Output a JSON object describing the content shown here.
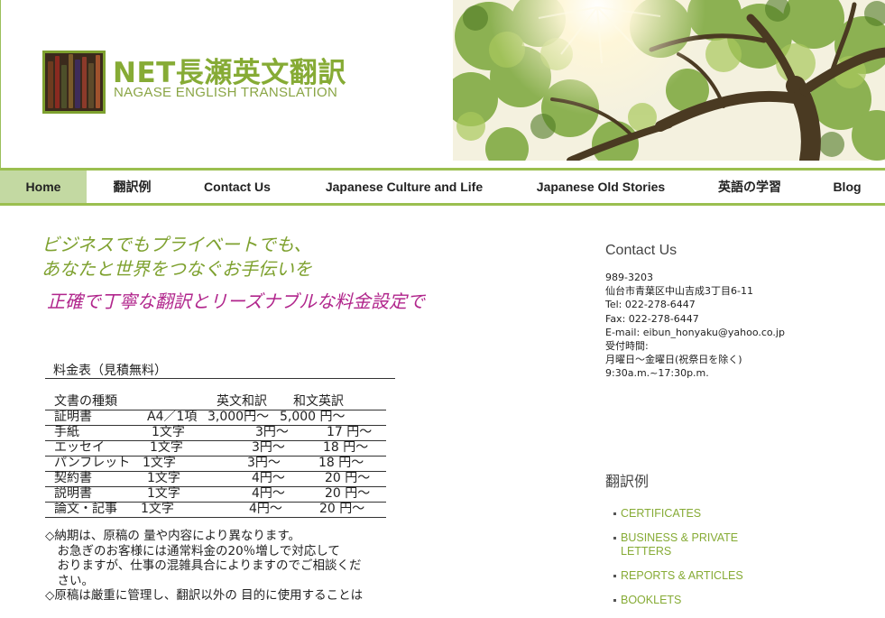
{
  "header": {
    "title": "NET長瀬英文翻訳",
    "subtitle": "NAGASE ENGLISH TRANSLATION"
  },
  "nav": {
    "items": [
      "Home",
      "翻訳例",
      "Contact Us",
      "Japanese Culture and Life",
      "Japanese Old Stories",
      "英語の学習",
      "Blog"
    ],
    "active": "Home"
  },
  "tagline": {
    "line1": "ビジネスでもプライベートでも、",
    "line2": "あなたと世界をつなぐお手伝いを",
    "line3": "正確で丁寧な翻訳とリーズナブルな料金設定で"
  },
  "pricing": {
    "title": "料金表（見積無料）",
    "headers": {
      "type": "文書の種類",
      "en_ja": "英文和訳",
      "ja_en": "和文英訳"
    },
    "rows": [
      {
        "type": "証明書",
        "unit": "A4／1項",
        "en_ja": "3,000円〜",
        "ja_en": "5,000 円〜"
      },
      {
        "type": "手紙",
        "unit": "1文字",
        "en_ja": "3円〜",
        "ja_en": "17 円〜"
      },
      {
        "type": "エッセイ",
        "unit": "1文字",
        "en_ja": "3円〜",
        "ja_en": "18 円〜"
      },
      {
        "type": "パンフレット",
        "unit": "1文字",
        "en_ja": "3円〜",
        "ja_en": "18 円〜"
      },
      {
        "type": "契約書",
        "unit": "1文字",
        "en_ja": "4円〜",
        "ja_en": "20 円〜"
      },
      {
        "type": "説明書",
        "unit": "1文字",
        "en_ja": "4円〜",
        "ja_en": "20 円〜"
      },
      {
        "type": "論文・記事",
        "unit": "1文字",
        "en_ja": "4円〜",
        "ja_en": "20 円〜"
      }
    ]
  },
  "notes": [
    "◇納期は、原稿の 量や内容により異なります。",
    "　お急ぎのお客様には通常料金の20％増しで対応して",
    "　おりますが、仕事の混雑具合によりますのでご相談くだ",
    "　さい。",
    "◇原稿は厳重に管理し、翻訳以外の 目的に使用することは"
  ],
  "sidebar": {
    "contact_heading": "Contact Us",
    "contact_lines": [
      "989-3203",
      "仙台市青葉区中山吉成3丁目6-11",
      "Tel: 022-278-6447",
      "Fax: 022-278-6447",
      "E-mail: eibun_honyaku@yahoo.co.jp",
      "受付時間:",
      "月曜日～金曜日(祝祭日を除く)",
      "9:30a.m.~17:30p.m."
    ],
    "examples_heading": "翻訳例",
    "examples": [
      "CERTIFICATES",
      "BUSINESS & PRIVATE LETTERS",
      "REPORTS & ARTICLES",
      "BOOKLETS"
    ]
  },
  "colors": {
    "brand_green": "#86ab35",
    "nav_border": "#9bbf4f",
    "nav_active_bg": "#c3d9a2",
    "accent_magenta": "#b1268c"
  }
}
